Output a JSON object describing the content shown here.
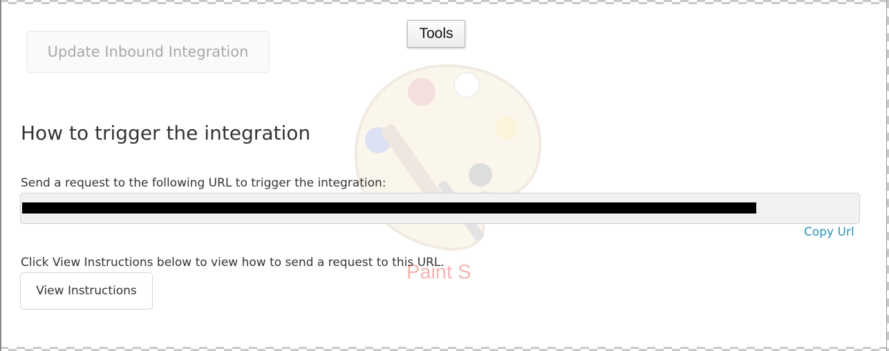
{
  "toolbar": {
    "tools_label": "Tools"
  },
  "header": {
    "update_button_label": "Update Inbound Integration"
  },
  "trigger_section": {
    "title": "How to trigger the integration",
    "url_label": "Send a request to the following URL to trigger the integration:",
    "url_value_redacted": true,
    "copy_url_label": "Copy Url",
    "instructions_text": "Click View Instructions below to view how to send a request to this URL.",
    "view_instructions_label": "View Instructions"
  },
  "watermark": {
    "icon": "paint-palette-icon",
    "text": "Paint S"
  },
  "colors": {
    "link": "#2a92b8",
    "disabled_text": "#a8a8a8",
    "redaction": "#000000"
  }
}
